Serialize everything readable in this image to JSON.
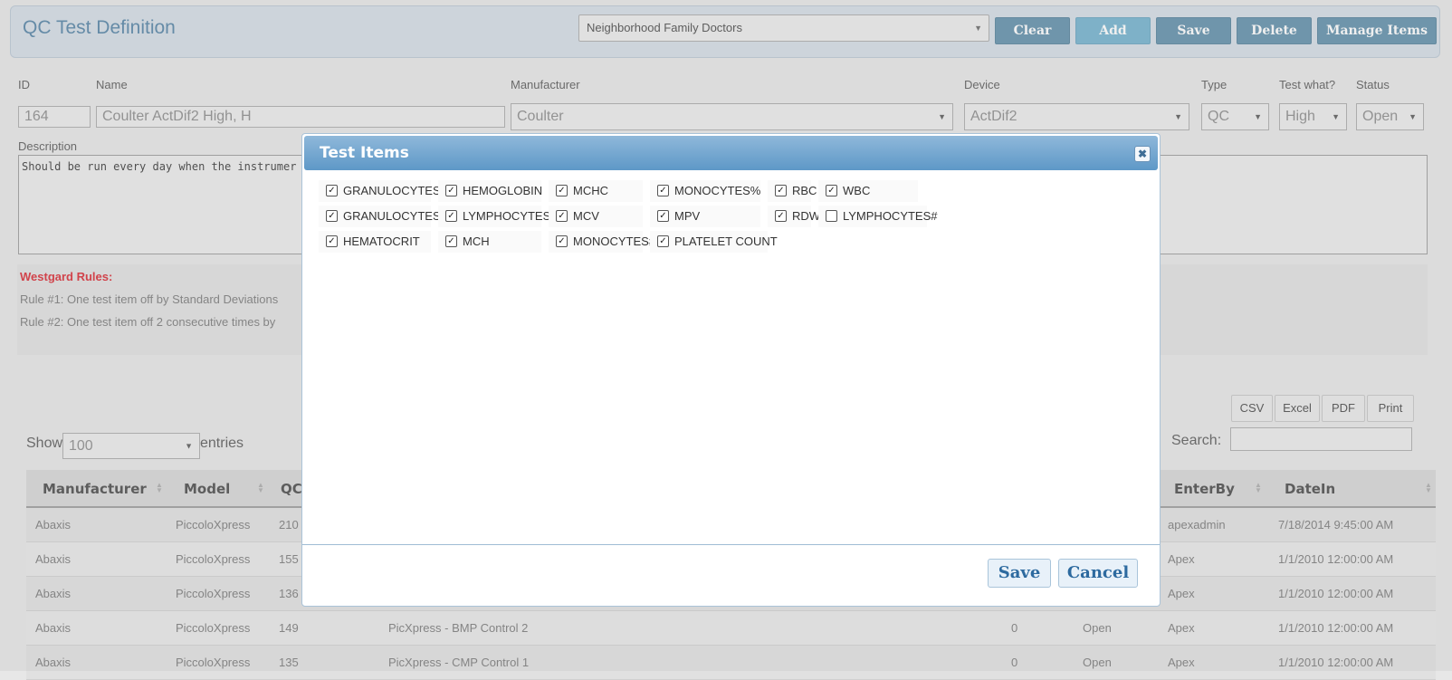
{
  "header": {
    "title": "QC Test Definition",
    "clinic": "Neighborhood Family Doctors",
    "buttons": {
      "clear": "Clear",
      "add": "Add",
      "save": "Save",
      "delete": "Delete",
      "manage": "Manage Items"
    }
  },
  "form": {
    "labels": {
      "id": "ID",
      "name": "Name",
      "manufacturer": "Manufacturer",
      "device": "Device",
      "type": "Type",
      "test_what": "Test what?",
      "status": "Status",
      "description": "Description"
    },
    "values": {
      "id": "164",
      "name": "Coulter ActDif2 High, H",
      "manufacturer": "Coulter",
      "device": "ActDif2",
      "type": "QC",
      "test_what": "High",
      "status": "Open"
    },
    "description": "Should be run every day when the instrumer"
  },
  "rules": {
    "title": "Westgard Rules:",
    "items": [
      "Rule #1: One test item off by Standard Deviations",
      "Rule #2: One test item off 2 consecutive times by"
    ]
  },
  "table": {
    "export": [
      "CSV",
      "Excel",
      "PDF",
      "Print"
    ],
    "show_label": "Show",
    "entries_label": "entries",
    "page_size": "100",
    "search_label": "Search:",
    "headers": {
      "manufacturer": "Manufacturer",
      "model": "Model",
      "qc": "QC",
      "enterby": "EnterBy",
      "datein": "DateIn"
    },
    "rows": [
      {
        "manufacturer": "Abaxis",
        "model": "PiccoloXpress",
        "qc": "210",
        "name": "",
        "count": "",
        "status": "",
        "enterby": "apexadmin",
        "datein": "7/18/2014 9:45:00 AM"
      },
      {
        "manufacturer": "Abaxis",
        "model": "PiccoloXpress",
        "qc": "155",
        "name": "",
        "count": "",
        "status": "",
        "enterby": "Apex",
        "datein": "1/1/2010 12:00:00 AM"
      },
      {
        "manufacturer": "Abaxis",
        "model": "PiccoloXpress",
        "qc": "136",
        "name": "",
        "count": "",
        "status": "",
        "enterby": "Apex",
        "datein": "1/1/2010 12:00:00 AM"
      },
      {
        "manufacturer": "Abaxis",
        "model": "PiccoloXpress",
        "qc": "149",
        "name": "PicXpress - BMP Control 2",
        "count": "0",
        "status": "Open",
        "enterby": "Apex",
        "datein": "1/1/2010 12:00:00 AM"
      },
      {
        "manufacturer": "Abaxis",
        "model": "PiccoloXpress",
        "qc": "135",
        "name": "PicXpress - CMP Control 1",
        "count": "0",
        "status": "Open",
        "enterby": "Apex",
        "datein": "1/1/2010 12:00:00 AM"
      }
    ]
  },
  "modal": {
    "title": "Test Items",
    "close": "✖",
    "items": [
      {
        "label": "GRANULOCYTES#",
        "checked": true
      },
      {
        "label": "HEMOGLOBIN",
        "checked": true
      },
      {
        "label": "MCHC",
        "checked": true
      },
      {
        "label": "MONOCYTES%",
        "checked": true
      },
      {
        "label": "RBC",
        "checked": true
      },
      {
        "label": "WBC",
        "checked": true
      },
      {
        "label": "GRANULOCYTES%",
        "checked": true
      },
      {
        "label": "LYMPHOCYTES%",
        "checked": true
      },
      {
        "label": "MCV",
        "checked": true
      },
      {
        "label": "MPV",
        "checked": true
      },
      {
        "label": "RDW",
        "checked": true
      },
      {
        "label": "LYMPHOCYTES#",
        "checked": false
      },
      {
        "label": "HEMATOCRIT",
        "checked": true
      },
      {
        "label": "MCH",
        "checked": true
      },
      {
        "label": "MONOCYTES#",
        "checked": true
      },
      {
        "label": "PLATELET COUNT",
        "checked": true
      }
    ],
    "save": "Save",
    "cancel": "Cancel"
  }
}
